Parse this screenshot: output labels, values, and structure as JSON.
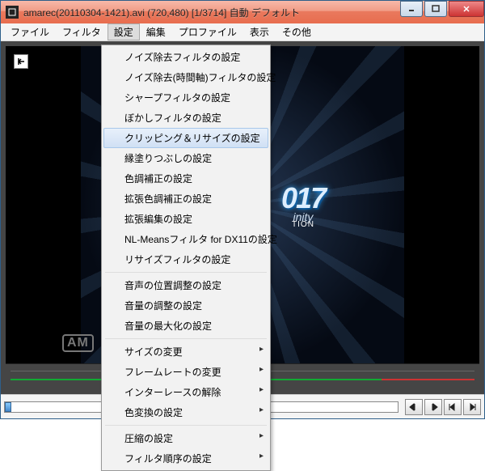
{
  "title": "amarec(20110304-1421).avi (720,480)  [1/3714]  自動  デフォルト",
  "menubar": [
    "ファイル",
    "フィルタ",
    "設定",
    "編集",
    "プロファイル",
    "表示",
    "その他"
  ],
  "active_menu_index": 2,
  "dropdown": {
    "groups": [
      [
        {
          "label": "ノイズ除去フィルタの設定",
          "sub": false
        },
        {
          "label": "ノイズ除去(時間軸)フィルタの設定",
          "sub": false
        },
        {
          "label": "シャープフィルタの設定",
          "sub": false
        },
        {
          "label": "ぼかしフィルタの設定",
          "sub": false
        },
        {
          "label": "クリッピング＆リサイズの設定",
          "sub": false,
          "highlighted": true
        },
        {
          "label": "縁塗りつぶしの設定",
          "sub": false
        },
        {
          "label": "色調補正の設定",
          "sub": false
        },
        {
          "label": "拡張色調補正の設定",
          "sub": false
        },
        {
          "label": "拡張編集の設定",
          "sub": false
        },
        {
          "label": "NL-Meansフィルタ for DX11の設定",
          "sub": false
        },
        {
          "label": "リサイズフィルタの設定",
          "sub": false
        }
      ],
      [
        {
          "label": "音声の位置調整の設定",
          "sub": false
        },
        {
          "label": "音量の調整の設定",
          "sub": false
        },
        {
          "label": "音量の最大化の設定",
          "sub": false
        }
      ],
      [
        {
          "label": "サイズの変更",
          "sub": true
        },
        {
          "label": "フレームレートの変更",
          "sub": true
        },
        {
          "label": "インターレースの解除",
          "sub": true
        },
        {
          "label": "色変換の設定",
          "sub": true
        }
      ],
      [
        {
          "label": "圧縮の設定",
          "sub": true
        },
        {
          "label": "フィルタ順序の設定",
          "sub": true
        }
      ]
    ]
  },
  "video": {
    "logo_main": "017",
    "logo_sub": "inity",
    "logo_edition": "TION",
    "watermark": "AM"
  }
}
